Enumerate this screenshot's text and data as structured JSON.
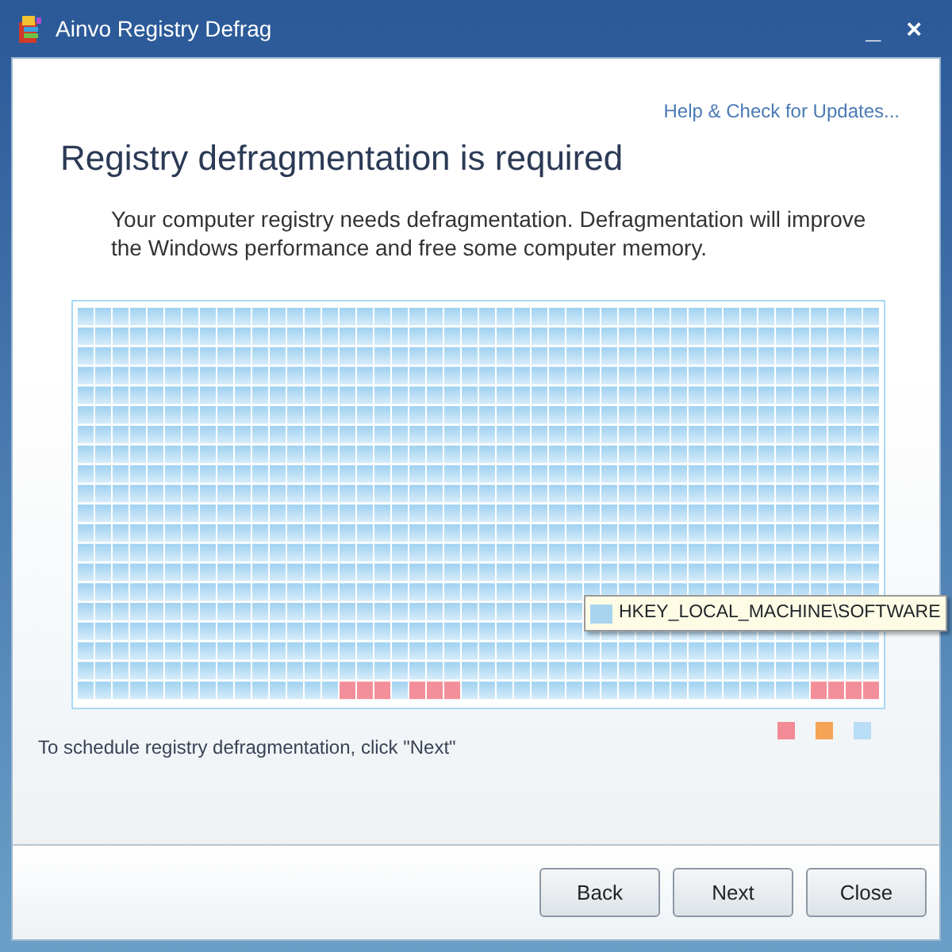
{
  "window": {
    "title": "Ainvo Registry Defrag",
    "controls": [
      "_",
      "×"
    ]
  },
  "help_link": "Help & Check for Updates...",
  "heading": "Registry defragmentation is required",
  "description": "Your computer registry needs defragmentation. Defragmentation will improve the Windows performance and free some computer memory.",
  "tooltip": {
    "text": "HKEY_LOCAL_MACHINE\\SOFTWARE",
    "color": "#a8d4f0"
  },
  "instruction": "To schedule registry defragmentation, click \"Next\"",
  "legend": [
    {
      "color": "#f28b96"
    },
    {
      "color": "#f5a455"
    },
    {
      "color": "#b8ddf5"
    }
  ],
  "buttons": [
    "Back",
    "Next",
    "Close"
  ]
}
